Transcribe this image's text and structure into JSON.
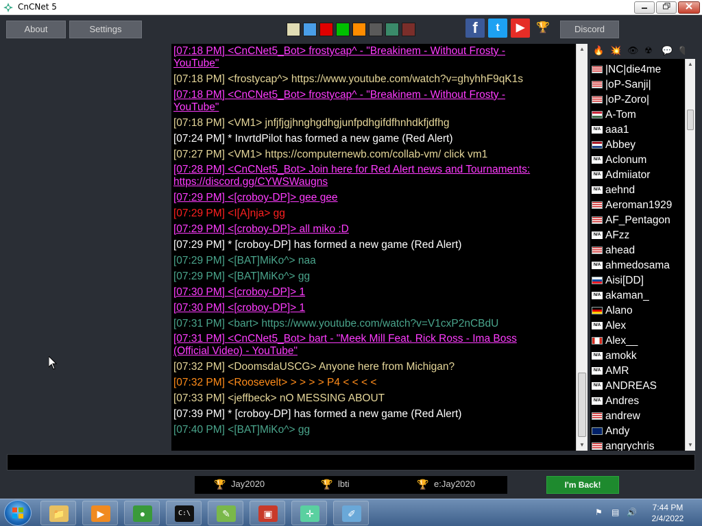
{
  "window": {
    "title": "CnCNet 5"
  },
  "toolbar": {
    "about_label": "About",
    "settings_label": "Settings",
    "discord_label": "Discord",
    "swatches": [
      "#e0dcb4",
      "#4a9ee8",
      "#e00000",
      "#00c000",
      "#ff8c00",
      "#5a5a5a",
      "#3a8a6a",
      "#7a2e2a"
    ],
    "social": {
      "facebook": {
        "glyph": "f",
        "color": "#3b5998"
      },
      "twitter": {
        "glyph": "t",
        "color": "#1da1f2"
      },
      "youtube": {
        "glyph": "▶",
        "color": "#e52d27"
      },
      "trophy": {
        "glyph": "🏆",
        "color": "#2a2e35"
      }
    }
  },
  "chat": {
    "messages": [
      {
        "time": "[07:18 PM]",
        "text": "<CnCNet5_Bot> frostycap^ - \"Breakinem - Without Frosty -",
        "text2": "YouTube\"",
        "color": "#ff3cff",
        "link": true
      },
      {
        "time": "[07:18 PM]",
        "text": "<frostycap^> https://www.youtube.com/watch?v=ghyhhF9qK1s",
        "color": "#e6d79a",
        "link": false
      },
      {
        "time": "[07:18 PM]",
        "text": "<CnCNet5_Bot> frostycap^ - \"Breakinem - Without Frosty -",
        "text2": "YouTube\"",
        "color": "#ff3cff",
        "link": true
      },
      {
        "time": "[07:18 PM]",
        "text": "<VM1> jnfjfjgjhnghgdhgjunfpdhgifdfhnhdkfjdfhg",
        "color": "#e6d79a",
        "link": false
      },
      {
        "time": "[07:24 PM]",
        "text": "* InvrtdPilot has formed a new game (Red Alert)",
        "color": "#ffffff",
        "link": false
      },
      {
        "time": "[07:27 PM]",
        "text": "<VM1> https://computernewb.com/collab-vm/ click vm1",
        "color": "#e6d79a",
        "link": false
      },
      {
        "time": "[07:28 PM]",
        "text": "<CnCNet5_Bot> Join here for Red Alert news and Tournaments:",
        "text2": "https://discord.gg/CYWSWaugns",
        "color": "#ff3cff",
        "link": true
      },
      {
        "time": "[07:29 PM]",
        "text": "<[croboy-DP]> gee gee",
        "color": "#ff3cff",
        "link": true
      },
      {
        "time": "[07:29 PM]",
        "text": "<I[A]nja> gg",
        "color": "#ff2020",
        "link": false
      },
      {
        "time": "[07:29 PM]",
        "text": "<[croboy-DP]> all miko :D",
        "color": "#ff3cff",
        "link": true
      },
      {
        "time": "[07:29 PM]",
        "text": "* [croboy-DP] has formed a new game (Red Alert)",
        "color": "#ffffff",
        "link": false
      },
      {
        "time": "[07:29 PM]",
        "text": "<[BAT]MiKo^> naa",
        "color": "#4aa58c",
        "link": false
      },
      {
        "time": "[07:29 PM]",
        "text": "<[BAT]MiKo^> gg",
        "color": "#4aa58c",
        "link": false
      },
      {
        "time": "[07:30 PM]",
        "text": "<[croboy-DP]> 1",
        "color": "#ff3cff",
        "link": true
      },
      {
        "time": "[07:30 PM]",
        "text": "<[croboy-DP]> 1",
        "color": "#ff3cff",
        "link": true
      },
      {
        "time": "[07:31 PM]",
        "text": "<bart> https://www.youtube.com/watch?v=V1cxP2nCBdU",
        "color": "#4aa58c",
        "link": false
      },
      {
        "time": "[07:31 PM]",
        "text": "<CnCNet5_Bot> bart - \"Meek Mill Feat. Rick Ross - Ima Boss",
        "text2": "(Official Video) - YouTube\"",
        "color": "#ff3cff",
        "link": true
      },
      {
        "time": "[07:32 PM]",
        "text": "<DoomsdaUSCG> Anyone here from Michigan?",
        "color": "#e6d79a",
        "link": false
      },
      {
        "time": "[07:32 PM]",
        "text": "<Roosevelt> > > > > P4 < < < <",
        "color": "#ff8c1a",
        "link": false
      },
      {
        "time": "[07:33 PM]",
        "text": "<jeffbeck> nO MESSING ABOUT",
        "color": "#e6d79a",
        "link": false
      },
      {
        "time": "[07:39 PM]",
        "text": "* [croboy-DP] has formed a new game (Red Alert)",
        "color": "#ffffff",
        "link": false
      },
      {
        "time": "[07:40 PM]",
        "text": "<[BAT]MiKo^> gg",
        "color": "#4aa58c",
        "link": false
      }
    ]
  },
  "userlist": {
    "filter_icons": [
      "🔥",
      "💥",
      "👁",
      "☢",
      "💬",
      "🖤"
    ],
    "users": [
      {
        "name": "|NC|die4me",
        "flag": "us"
      },
      {
        "name": "|oP-Sanji|",
        "flag": "us"
      },
      {
        "name": "|oP-Zoro|",
        "flag": "us"
      },
      {
        "name": "A-Tom",
        "flag": "hu"
      },
      {
        "name": "aaa1",
        "flag": "na"
      },
      {
        "name": "Abbey",
        "flag": "nl"
      },
      {
        "name": "Aclonum",
        "flag": "na"
      },
      {
        "name": "Admiiator",
        "flag": "na"
      },
      {
        "name": "aehnd",
        "flag": "na"
      },
      {
        "name": "Aeroman1929",
        "flag": "us"
      },
      {
        "name": "AF_Pentagon",
        "flag": "us"
      },
      {
        "name": "AFzz",
        "flag": "na"
      },
      {
        "name": "ahead",
        "flag": "us"
      },
      {
        "name": "ahmedosama",
        "flag": "na"
      },
      {
        "name": "Aisi[DD]",
        "flag": "sk"
      },
      {
        "name": "akaman_",
        "flag": "na"
      },
      {
        "name": "Alano",
        "flag": "de"
      },
      {
        "name": "Alex",
        "flag": "na"
      },
      {
        "name": "Alex__",
        "flag": "ca"
      },
      {
        "name": "amokk",
        "flag": "na"
      },
      {
        "name": "AMR",
        "flag": "na"
      },
      {
        "name": "ANDREAS",
        "flag": "na"
      },
      {
        "name": "Andres",
        "flag": "na"
      },
      {
        "name": "andrew",
        "flag": "us"
      },
      {
        "name": "Andy",
        "flag": "au"
      },
      {
        "name": "angrychris",
        "flag": "us"
      }
    ],
    "na_text": "N/A"
  },
  "ladder": {
    "items": [
      {
        "label": "Jay2020",
        "trophy": "🏆",
        "trophy_color": "#e0a030"
      },
      {
        "label": "lbti",
        "trophy": "🏆",
        "trophy_color": "#c8c8c8"
      },
      {
        "label": "e:Jay2020",
        "trophy": "🏆",
        "trophy_color": "#e06030"
      }
    ]
  },
  "back_button": {
    "label": "I'm Back!"
  },
  "taskbar": {
    "apps": [
      {
        "name": "explorer",
        "glyph": "📁",
        "bg": "#e8c060"
      },
      {
        "name": "media-player",
        "glyph": "▶",
        "bg": "#f08a20"
      },
      {
        "name": "chrome",
        "glyph": "●",
        "bg": "#3a9a3a"
      },
      {
        "name": "command-prompt",
        "glyph": "C:\\",
        "bg": "#111111"
      },
      {
        "name": "notepad-plus",
        "glyph": "✎",
        "bg": "#7ab84a"
      },
      {
        "name": "toolbox",
        "glyph": "▣",
        "bg": "#c83a2a"
      },
      {
        "name": "cncnet",
        "glyph": "✛",
        "bg": "#5ad0a0"
      },
      {
        "name": "notepad",
        "glyph": "✐",
        "bg": "#6aa8d8"
      }
    ],
    "time": "7:44 PM",
    "date": "2/4/2022"
  }
}
